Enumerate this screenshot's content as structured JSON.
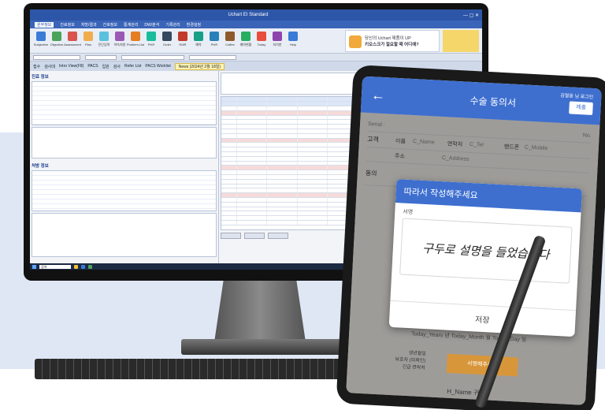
{
  "monitor": {
    "window_title": "Uchart EI Standard",
    "menu": [
      "원무정보",
      "진료정보",
      "처방/결과",
      "간호정보",
      "통계관리",
      "DW/분석",
      "기록관리",
      "환경설정"
    ],
    "ribbon": [
      {
        "label": "Subjective",
        "color": "#3a7bd5"
      },
      {
        "label": "Objective",
        "color": "#4aa35a"
      },
      {
        "label": "Assessment",
        "color": "#d9534f"
      },
      {
        "label": "Plan",
        "color": "#f0ad4e"
      },
      {
        "label": "진단입력",
        "color": "#5bc0de"
      },
      {
        "label": "약속처방",
        "color": "#9b59b6"
      },
      {
        "label": "Problem List",
        "color": "#e67e22"
      },
      {
        "label": "PHR",
        "color": "#1abc9c"
      },
      {
        "label": "Order",
        "color": "#34495e"
      },
      {
        "label": "EMR",
        "color": "#c0392b"
      },
      {
        "label": "예약",
        "color": "#16a085"
      },
      {
        "label": "PHR",
        "color": "#2980b9"
      },
      {
        "label": "Coffee",
        "color": "#8e5a2b"
      },
      {
        "label": "예약현황",
        "color": "#27ae60"
      },
      {
        "label": "Today",
        "color": "#e74c3c"
      },
      {
        "label": "처치판",
        "color": "#8e44ad"
      },
      {
        "label": "Help",
        "color": "#3a7bd5"
      }
    ],
    "ad_line1": "당신의 Uchart 제품이 UP",
    "ad_line2": "키오스크가 필요할 때 어디에?",
    "toolbar3": [
      "접수",
      "검사대",
      "Intro View(F8)",
      "PACS",
      "입원",
      "검사",
      "Refer List",
      "PACS Worklist"
    ],
    "news": "News (2024년 2월 18일)",
    "sec_patient": "진료 정보",
    "sec_order": "처방 정보",
    "taskbar_search": "검색"
  },
  "tablet": {
    "header_title": "수술 동의서",
    "user": "김철동 님 로그인",
    "submit_label": "제출",
    "serial_label": "Serial :",
    "no_label": "No.",
    "customer_label": "고객",
    "name_label": "이름",
    "name_val": "C_Name",
    "tel_label": "연락처",
    "tel_val": "C_Tel",
    "mobile_label": "핸드폰",
    "mobile_val": "C_Mobile",
    "addr_label": "주소",
    "addr_val": "C_Address",
    "consent_label": "동의",
    "dialog_title": "따라서 작성해주세요",
    "sig_label": "서명",
    "signature_text": "구두로 설명을 들었습니다",
    "save_label": "저장",
    "date_line": "Today_Years 년 Today_Month 월 Today_Day 일",
    "birth_label": "생년월일",
    "guardian_label": "보호자 (의뢰인)",
    "emergency_label": "긴급 연락처",
    "sign_button": "서명해주세요",
    "recipient": "H_Name 귀하"
  }
}
